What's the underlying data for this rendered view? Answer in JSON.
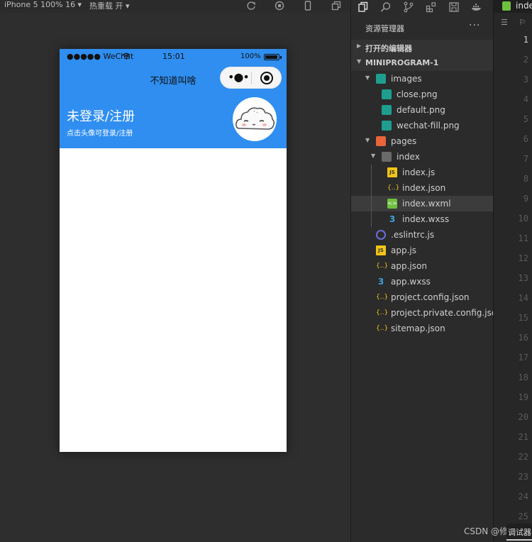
{
  "simulator": {
    "device_label": "iPhone 5 100% 16 ▾",
    "hot_reload_label": "热重载 开 ▾"
  },
  "phone": {
    "status_bar": {
      "carrier": "●●●●● WeChat",
      "time": "15:01",
      "battery_pct": "100%"
    },
    "nav_title": "不知道叫啥",
    "capsule_more": "•●•",
    "login_title": "未登录/注册",
    "login_hint": "点击头像可登录/注册"
  },
  "explorer": {
    "title": "资源管理器",
    "more": "···",
    "open_editors": "打开的编辑器",
    "project": "MINIPROGRAM-1",
    "tree": [
      {
        "name": "images",
        "type": "folder-img",
        "indent": 1,
        "expanded": true
      },
      {
        "name": "close.png",
        "type": "img",
        "indent": 2
      },
      {
        "name": "default.png",
        "type": "img",
        "indent": 2
      },
      {
        "name": "wechat-fill.png",
        "type": "img",
        "indent": 2
      },
      {
        "name": "pages",
        "type": "folder-pages",
        "indent": 1,
        "expanded": true
      },
      {
        "name": "index",
        "type": "folder",
        "indent": 2,
        "expanded": true
      },
      {
        "name": "index.js",
        "type": "js",
        "indent": 3
      },
      {
        "name": "index.json",
        "type": "json",
        "indent": 3
      },
      {
        "name": "index.wxml",
        "type": "wxml",
        "indent": 3,
        "selected": true
      },
      {
        "name": "index.wxss",
        "type": "wxss",
        "indent": 3
      },
      {
        "name": ".eslintrc.js",
        "type": "eslint",
        "indent": 1
      },
      {
        "name": "app.js",
        "type": "js",
        "indent": 1
      },
      {
        "name": "app.json",
        "type": "json",
        "indent": 1
      },
      {
        "name": "app.wxss",
        "type": "wxss",
        "indent": 1
      },
      {
        "name": "project.config.json",
        "type": "json",
        "indent": 1
      },
      {
        "name": "project.private.config.json",
        "type": "json",
        "indent": 1
      },
      {
        "name": "sitemap.json",
        "type": "json",
        "indent": 1
      }
    ]
  },
  "editor": {
    "tab_name": "inde",
    "line_numbers": [
      "1",
      "2",
      "3",
      "4",
      "5",
      "6",
      "7",
      "8",
      "9",
      "10",
      "11",
      "12",
      "13",
      "14",
      "15",
      "16",
      "17",
      "18",
      "19",
      "20",
      "21",
      "22",
      "23",
      "24",
      "25"
    ],
    "debug_tab": "调试器"
  },
  "watermark": "CSDN @修"
}
